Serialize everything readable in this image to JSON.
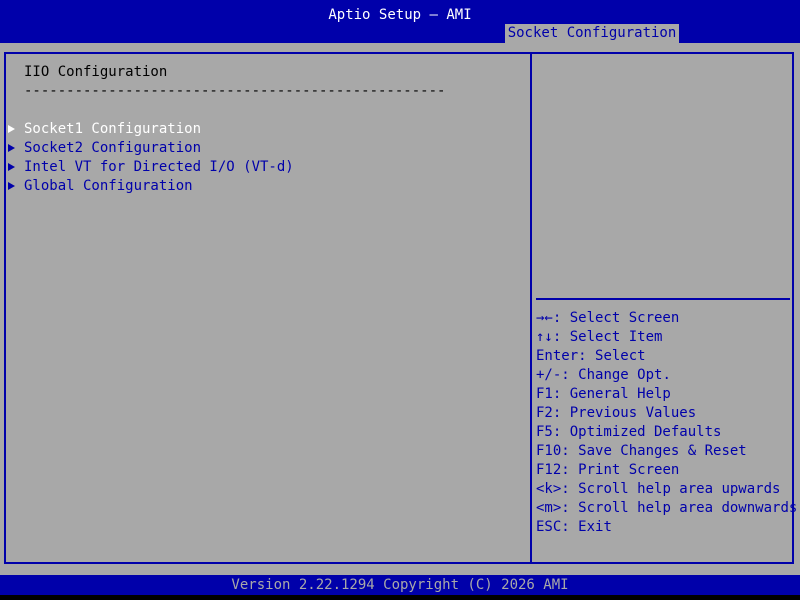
{
  "header": {
    "title": "Aptio Setup – AMI",
    "active_tab": "Socket Configuration"
  },
  "main": {
    "section_title": "IIO Configuration",
    "section_rule": "--------------------------------------------------",
    "items": [
      {
        "label": "Socket1 Configuration",
        "selected": true
      },
      {
        "label": "Socket2 Configuration",
        "selected": false
      },
      {
        "label": "Intel VT for Directed I/O (VT-d)",
        "selected": false
      },
      {
        "label": "Global Configuration",
        "selected": false
      }
    ]
  },
  "help": {
    "keys": [
      {
        "key": "→←",
        "desc": ": Select Screen"
      },
      {
        "key": "↑↓",
        "desc": ": Select Item"
      },
      {
        "key": "Enter",
        "desc": ": Select"
      },
      {
        "key": "+/-",
        "desc": ": Change Opt."
      },
      {
        "key": "F1",
        "desc": ": General Help"
      },
      {
        "key": "F2",
        "desc": ": Previous Values"
      },
      {
        "key": "F5",
        "desc": ": Optimized Defaults"
      },
      {
        "key": "F10",
        "desc": ": Save Changes & Reset"
      },
      {
        "key": "F12",
        "desc": ": Print Screen"
      },
      {
        "key": "<k>",
        "desc": ": Scroll help area upwards"
      },
      {
        "key": "<m>",
        "desc": ": Scroll help area downwards"
      },
      {
        "key": "ESC",
        "desc": ": Exit"
      }
    ]
  },
  "footer": {
    "text": "Version 2.22.1294 Copyright (C) 2026 AMI"
  },
  "colors": {
    "background": "#a8a8a8",
    "accent": "#0000aa",
    "selected_text": "#ffffff"
  }
}
